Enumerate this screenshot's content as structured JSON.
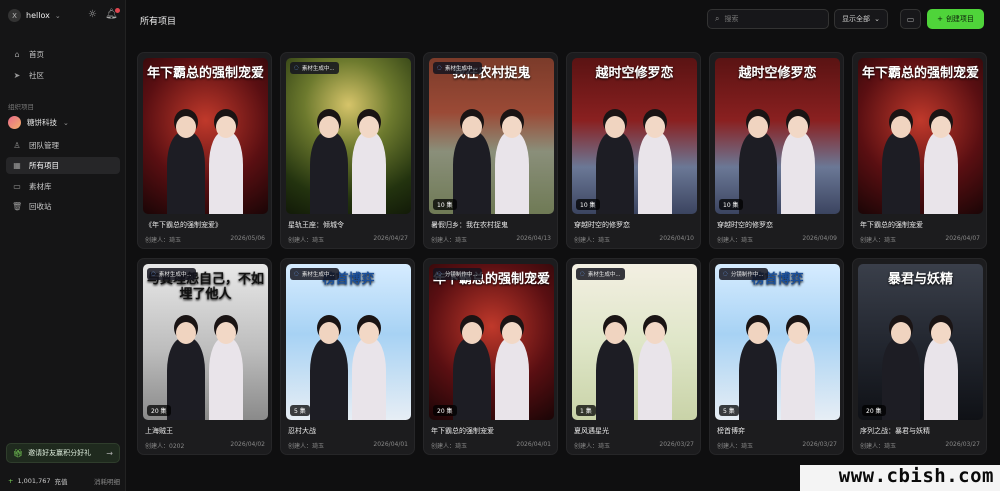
{
  "sidebar": {
    "workspace": {
      "avatar": "X",
      "name": "hellox"
    },
    "nav": [
      {
        "label": "首页",
        "icon": "home-icon"
      },
      {
        "label": "社区",
        "icon": "send-icon"
      }
    ],
    "section_label": "组织项目",
    "team": {
      "name": "糖饼科技"
    },
    "team_nav": [
      {
        "label": "团队管理",
        "icon": "user-icon"
      },
      {
        "label": "所有项目",
        "icon": "grid-icon",
        "active": true
      },
      {
        "label": "素材库",
        "icon": "folder-icon"
      },
      {
        "label": "回收站",
        "icon": "trash-icon"
      }
    ],
    "invite": "邀请好友赢积分好礼",
    "credits": {
      "amount": "1,001,767",
      "recharge": "充值",
      "details": "消耗明细"
    }
  },
  "header": {
    "title": "所有项目",
    "search_placeholder": "搜索",
    "filter": "显示全部",
    "create": "创建项目"
  },
  "projects": [
    {
      "title": "《年下霸总的强制宠爱》",
      "creator": "创建人：琦玉",
      "date": "2026/05/06",
      "episodes": "",
      "tag": "",
      "art": "年下霸总的强制宠爱",
      "theme": "t-red",
      "art_color": "#ffffff"
    },
    {
      "title": "星轨王座：倾城令",
      "creator": "创建人：琦玉",
      "date": "2026/04/27",
      "episodes": "",
      "tag": "素材生成中...",
      "art": "",
      "theme": "t-forest",
      "art_color": "#ffffff"
    },
    {
      "title": "暑假归乡：我在农村捉鬼",
      "creator": "创建人：琦玉",
      "date": "2026/04/13",
      "episodes": "10 集",
      "tag": "素材生成中...",
      "art": "我在农村捉鬼",
      "theme": "t-village",
      "art_color": "#ffffff"
    },
    {
      "title": "穿越时空的修罗恋",
      "creator": "创建人：琦玉",
      "date": "2026/04/10",
      "episodes": "10 集",
      "tag": "",
      "art": "越时空修罗恋",
      "theme": "t-temple",
      "art_color": "#ffffff"
    },
    {
      "title": "穿越时空的修罗恋",
      "creator": "创建人：琦玉",
      "date": "2026/04/09",
      "episodes": "10 集",
      "tag": "",
      "art": "越时空修罗恋",
      "theme": "t-temple",
      "art_color": "#ffffff"
    },
    {
      "title": "年下霸总的强制宠爱",
      "creator": "创建人：琦玉",
      "date": "2026/04/07",
      "episodes": "",
      "tag": "",
      "art": "年下霸总的强制宠爱",
      "theme": "t-red",
      "art_color": "#ffffff"
    },
    {
      "title": "上海贼王",
      "creator": "创建人：0202",
      "date": "2026/04/02",
      "episodes": "20 集",
      "tag": "素材生成中...",
      "art": "与其埋怨自己，不如埋了他人",
      "theme": "t-cat",
      "art_color": "#111111"
    },
    {
      "title": "忍村大战",
      "creator": "创建人：琦玉",
      "date": "2026/04/01",
      "episodes": "5 集",
      "tag": "素材生成中...",
      "art": "榜首博弈",
      "theme": "t-school",
      "art_color": "#1a4f9a"
    },
    {
      "title": "年下霸总的强制宠爱",
      "creator": "创建人：琦玉",
      "date": "2026/04/01",
      "episodes": "20 集",
      "tag": "分镜制作中...",
      "art": "年下霸总的强制宠爱",
      "theme": "t-red",
      "art_color": "#ffffff"
    },
    {
      "title": "夏风遇星光",
      "creator": "创建人：琦玉",
      "date": "2026/03/27",
      "episodes": "1 集",
      "tag": "素材生成中...",
      "art": "",
      "theme": "t-court",
      "art_color": "#3a6b2a"
    },
    {
      "title": "榜首博弈",
      "creator": "创建人：琦玉",
      "date": "2026/03/27",
      "episodes": "5 集",
      "tag": "分镜制作中...",
      "art": "榜首博弈",
      "theme": "t-school",
      "art_color": "#1a4f9a"
    },
    {
      "title": "序列之战：暴君与妖精",
      "creator": "创建人：琦玉",
      "date": "2026/03/27",
      "episodes": "20 集",
      "tag": "",
      "art": "暴君与妖精",
      "theme": "t-war",
      "art_color": "#ffffff"
    }
  ],
  "watermark": "www.cbish.com",
  "colors": {
    "accent": "#4fd43a",
    "background": "#0f0f10"
  }
}
